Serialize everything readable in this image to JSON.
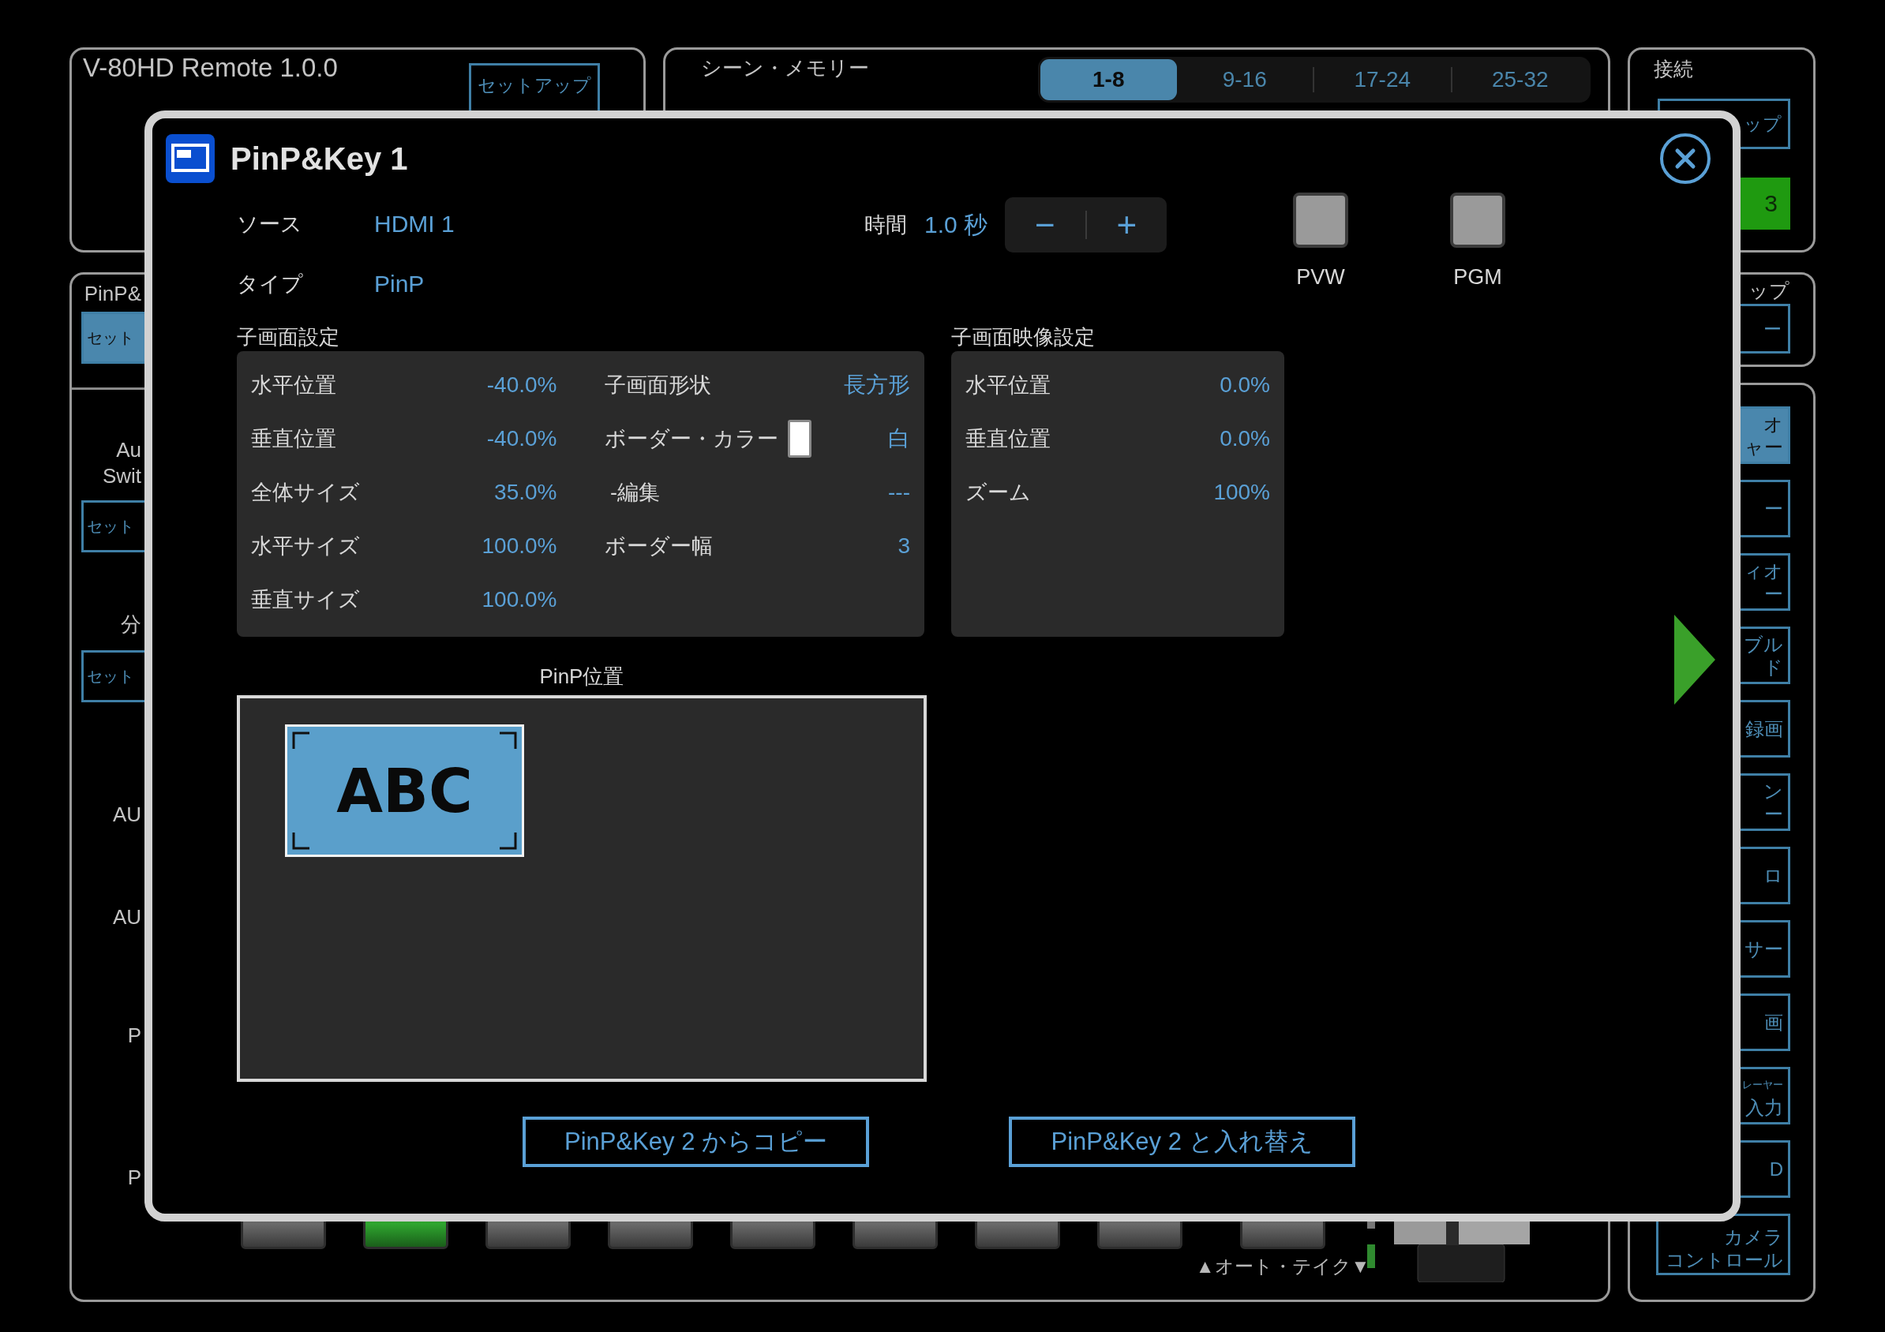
{
  "background": {
    "app_title": "V-80HD Remote 1.0.0",
    "setup_button": "セットアップ",
    "scene_memory": {
      "title": "シーン・メモリー",
      "tabs": [
        {
          "label": "1-8",
          "selected": true
        },
        {
          "label": "9-16",
          "selected": false
        },
        {
          "label": "17-24",
          "selected": false
        },
        {
          "label": "25-32",
          "selected": false
        }
      ]
    },
    "connection": {
      "title": "接続",
      "setup_button": "ップ",
      "status_button": "3"
    },
    "side_panel": {
      "title": "ップ",
      "button": "ー"
    },
    "left_strip": {
      "title": "PinP&",
      "button": "セット",
      "items": [
        {
          "kind": "label",
          "lines": [
            "Au",
            "Swit"
          ]
        },
        {
          "kind": "button",
          "lines": [
            "セット"
          ]
        },
        {
          "kind": "label",
          "lines": [
            "分"
          ]
        },
        {
          "kind": "button",
          "lines": [
            "セット"
          ]
        },
        {
          "kind": "label",
          "lines": [
            "AU"
          ]
        },
        {
          "kind": "label",
          "lines": [
            "AU"
          ]
        },
        {
          "kind": "label",
          "lines": [
            "P"
          ]
        },
        {
          "kind": "label",
          "lines": [
            "P"
          ]
        }
      ]
    },
    "right_buttons": [
      {
        "lines": [
          "オ",
          "ャー"
        ],
        "selected": true
      },
      {
        "lines": [
          "ー"
        ],
        "selected": false
      },
      {
        "lines": [
          "ィオ",
          "ー"
        ],
        "selected": false
      },
      {
        "lines": [
          "ブル",
          "ド"
        ],
        "selected": false
      },
      {
        "lines": [
          "録画"
        ],
        "selected": false
      },
      {
        "lines": [
          "ン",
          "ー"
        ],
        "selected": false
      },
      {
        "lines": [
          "ロ"
        ],
        "selected": false
      },
      {
        "lines": [
          "サー"
        ],
        "selected": false
      },
      {
        "lines": [
          "画"
        ],
        "selected": false
      },
      {
        "lines": [
          "レーヤー",
          "入力"
        ],
        "selected": false
      },
      {
        "lines": [
          "D"
        ],
        "selected": false
      },
      {
        "lines": [
          "カメラ",
          "コントロール"
        ],
        "selected": false
      }
    ],
    "bottom": {
      "buttons": [
        {
          "lit": false
        },
        {
          "lit": true
        },
        {
          "lit": false
        },
        {
          "lit": false
        },
        {
          "lit": false
        },
        {
          "lit": false
        },
        {
          "lit": false
        },
        {
          "lit": false
        }
      ],
      "take_button": {
        "lit": false
      },
      "auto_take": "▲オート・テイク▼"
    }
  },
  "dialog": {
    "title": "PinP&Key 1",
    "fields": [
      {
        "label": "ソース",
        "value": "HDMI 1"
      },
      {
        "label": "タイプ",
        "value": "PinP"
      }
    ],
    "time": {
      "label": "時間",
      "value": "1.0 秒",
      "minus": "−",
      "plus": "+"
    },
    "indicators": [
      {
        "label": "PVW",
        "on": false
      },
      {
        "label": "PGM",
        "on": false
      }
    ],
    "inset_settings": {
      "title": "子画面設定",
      "column_1": [
        {
          "label": "水平位置",
          "value": "-40.0%"
        },
        {
          "label": "垂直位置",
          "value": "-40.0%"
        },
        {
          "label": "全体サイズ",
          "value": "35.0%"
        },
        {
          "label": "水平サイズ",
          "value": "100.0%"
        },
        {
          "label": "垂直サイズ",
          "value": "100.0%"
        }
      ],
      "column_2": [
        {
          "label": "子画面形状",
          "value": "長方形",
          "kind": "text"
        },
        {
          "label": "ボーダー・カラー",
          "value": "白",
          "kind": "color"
        },
        {
          "label": " -編集",
          "value": "---",
          "kind": "text"
        },
        {
          "label": "ボーダー幅",
          "value": "3",
          "kind": "text"
        }
      ]
    },
    "inset_video": {
      "title": "子画面映像設定",
      "rows": [
        {
          "label": "水平位置",
          "value": "0.0%"
        },
        {
          "label": "垂直位置",
          "value": "0.0%"
        },
        {
          "label": "ズーム",
          "value": "100%"
        }
      ]
    },
    "position": {
      "title": "PinP位置",
      "inset_label": "ABC"
    },
    "buttons": [
      "PinP&Key 2 からコピー",
      "PinP&Key 2 と入れ替え"
    ]
  }
}
